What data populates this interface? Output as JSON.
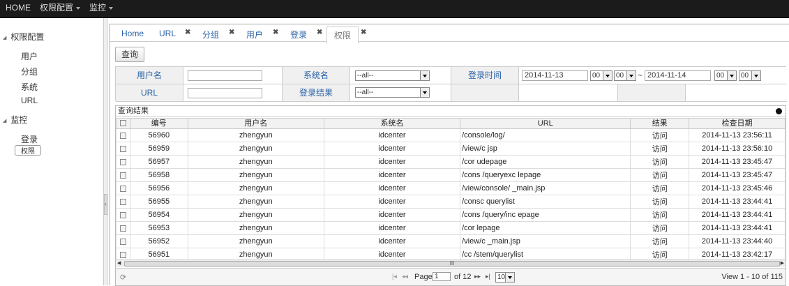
{
  "topnav": {
    "home": "HOME",
    "perm": "权限配置",
    "monitor": "监控"
  },
  "sidebar": {
    "group1": "权限配置",
    "group1_items": [
      "用户",
      "分组",
      "系统",
      "URL"
    ],
    "group2": "监控",
    "group2_items": [
      "登录",
      "权限"
    ]
  },
  "tabs": [
    {
      "label": "Home",
      "closable": false
    },
    {
      "label": "URL",
      "closable": true
    },
    {
      "label": "分组",
      "closable": true
    },
    {
      "label": "用户",
      "closable": true
    },
    {
      "label": "登录",
      "closable": true
    },
    {
      "label": "权限",
      "closable": true,
      "active": true
    }
  ],
  "close_glyph": "✖",
  "query_button": "查询",
  "form": {
    "username_label": "用户名",
    "username_value": "",
    "system_label": "系统名",
    "system_value": "--all--",
    "logintime_label": "登录时间",
    "date_from": "2014-11-13",
    "hour_from": "00",
    "min_from": "00",
    "tilde": "~",
    "date_to": "2014-11-14",
    "hour_to": "00",
    "min_to": "00",
    "url_label": "URL",
    "url_value": "",
    "result_label": "登录结果",
    "result_value": "--all--"
  },
  "grid": {
    "title": "查询结果",
    "columns": [
      "编号",
      "用户名",
      "系统名",
      "URL",
      "结果",
      "检查日期"
    ],
    "rows": [
      [
        "56960",
        "zhengyun",
        "idcenter",
        "/console/log/",
        "访问",
        "2014-11-13 23:56:11"
      ],
      [
        "56959",
        "zhengyun",
        "idcenter",
        "/view/c                                    jsp",
        "访问",
        "2014-11-13 23:56:10"
      ],
      [
        "56957",
        "zhengyun",
        "idcenter",
        "/cor                                 udepage",
        "访问",
        "2014-11-13 23:45:47"
      ],
      [
        "56958",
        "zhengyun",
        "idcenter",
        "/cons        /queryexc    lepage",
        "访问",
        "2014-11-13 23:45:47"
      ],
      [
        "56956",
        "zhengyun",
        "idcenter",
        "/view/console/                        _main.jsp",
        "访问",
        "2014-11-13 23:45:46"
      ],
      [
        "56955",
        "zhengyun",
        "idcenter",
        "/consc                 querylist",
        "访问",
        "2014-11-13 23:44:41"
      ],
      [
        "56954",
        "zhengyun",
        "idcenter",
        "/cons              /query/inc    epage",
        "访问",
        "2014-11-13 23:44:41"
      ],
      [
        "56953",
        "zhengyun",
        "idcenter",
        "/cor                              lepage",
        "访问",
        "2014-11-13 23:44:41"
      ],
      [
        "56952",
        "zhengyun",
        "idcenter",
        "/view/c                         _main.jsp",
        "访问",
        "2014-11-13 23:44:40"
      ],
      [
        "56951",
        "zhengyun",
        "idcenter",
        "/cc           /stem/querylist",
        "访问",
        "2014-11-13 23:42:17"
      ]
    ]
  },
  "pager": {
    "page_label": "Page",
    "page_value": "1",
    "of_label": "of 12",
    "page_size": "10",
    "summary": "View 1 - 10 of 115",
    "scroll_grip": "III"
  }
}
